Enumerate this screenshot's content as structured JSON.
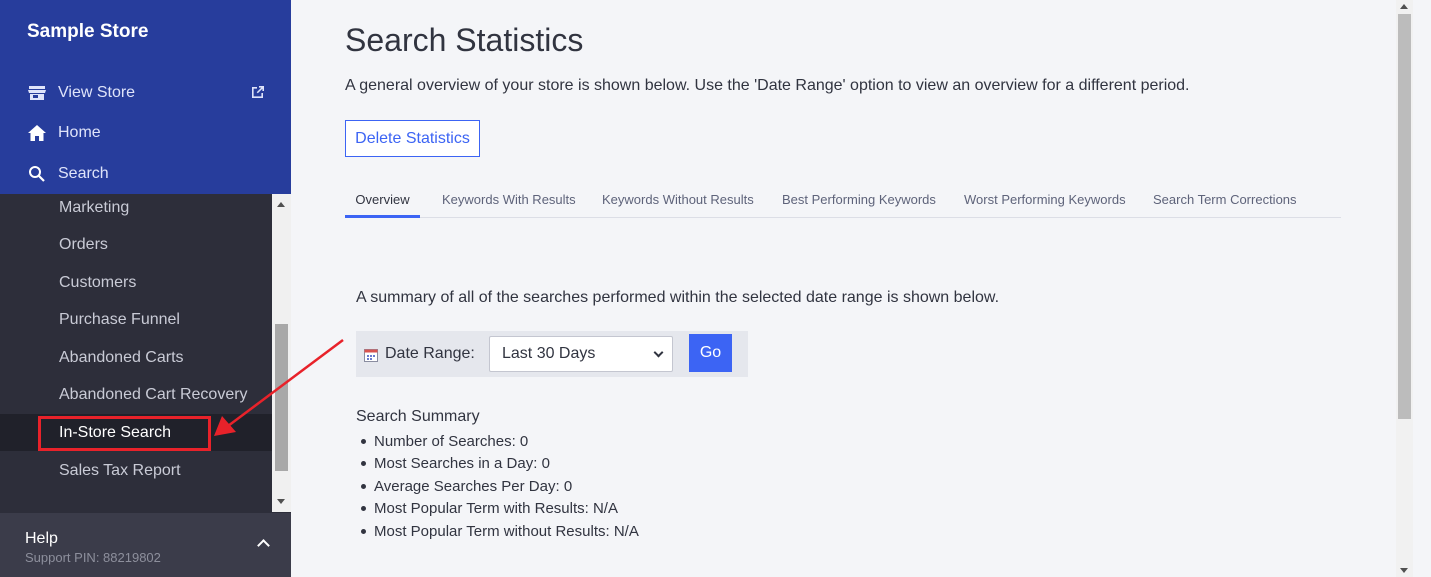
{
  "sidebar": {
    "store_name": "Sample Store",
    "top_items": [
      {
        "label": "View Store",
        "icon": "storefront-icon"
      },
      {
        "label": "Home",
        "icon": "home-icon"
      },
      {
        "label": "Search",
        "icon": "search-icon"
      }
    ],
    "sub_items": [
      {
        "label": "Marketing"
      },
      {
        "label": "Orders"
      },
      {
        "label": "Customers"
      },
      {
        "label": "Purchase Funnel"
      },
      {
        "label": "Abandoned Carts"
      },
      {
        "label": "Abandoned Cart Recovery"
      },
      {
        "label": "In-Store Search",
        "active": true
      },
      {
        "label": "Sales Tax Report"
      }
    ],
    "help": {
      "label": "Help",
      "pin": "Support PIN: 88219802"
    }
  },
  "main": {
    "title": "Search Statistics",
    "intro": "A general overview of your store is shown below. Use the 'Date Range' option to view an overview for a different period.",
    "delete_label": "Delete Statistics",
    "tabs": [
      {
        "label": "Overview",
        "active": true
      },
      {
        "label": "Keywords With Results"
      },
      {
        "label": "Keywords Without Results"
      },
      {
        "label": "Best Performing Keywords"
      },
      {
        "label": "Worst Performing Keywords"
      },
      {
        "label": "Search Term Corrections"
      }
    ],
    "summary_intro": "A summary of all of the searches performed within the selected date range is shown below.",
    "date_range": {
      "label": "Date Range:",
      "selected": "Last 30 Days",
      "go_label": "Go"
    },
    "summary_title": "Search Summary",
    "summary_items": [
      "Number of Searches: 0",
      "Most Searches in a Day: 0",
      "Average Searches Per Day: 0",
      "Most Popular Term with Results: N/A",
      "Most Popular Term without Results: N/A"
    ]
  },
  "colors": {
    "sidebar_top": "#273d9c",
    "sidebar": "#2d2e3a",
    "accent": "#3c64f4",
    "annotation": "#e8222a"
  }
}
